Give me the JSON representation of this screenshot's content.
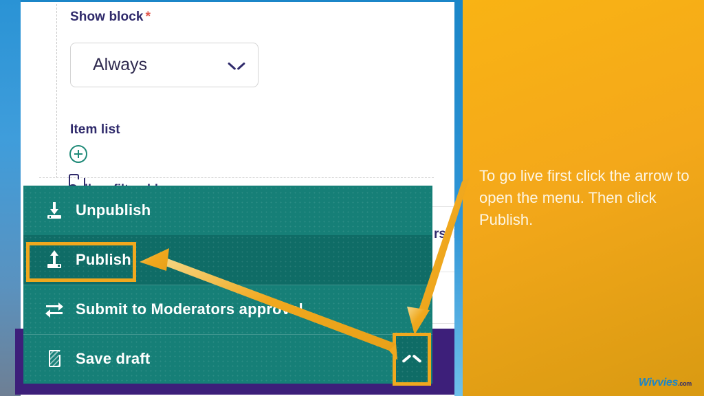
{
  "content_pane": {
    "show_block": {
      "label": "Show block",
      "required_marker": "*",
      "selected_value": "Always",
      "chevron_icon": "chevron-down-icon"
    },
    "item_list": {
      "label": "Item list",
      "add_icon": "plus-circle-icon",
      "rows": [
        {
          "icon": "folder-icon",
          "label": "Gallery filterable group"
        }
      ],
      "obscured_text_fragment": "rs, i"
    }
  },
  "action_menu": {
    "items": [
      {
        "label": "Unpublish",
        "icon": "download-icon",
        "highlighted": false
      },
      {
        "label": "Publish",
        "icon": "upload-icon",
        "highlighted": true
      },
      {
        "label": "Submit to Moderators approval",
        "icon": "exchange-arrows-icon",
        "highlighted": false
      },
      {
        "label": "Save draft",
        "icon": "document-icon",
        "highlighted": false
      }
    ],
    "toggle_button": {
      "icon": "chevron-up-icon",
      "highlighted": true
    }
  },
  "annotations": {
    "arrow_to_publish": "arrow-icon",
    "arrow_to_toggle": "arrow-icon",
    "highlight_color": "#f0a81e"
  },
  "instruction_panel": {
    "text": "To go live first click the arrow to open the menu. Then click Publish.",
    "background_color": "#f4a81a"
  },
  "watermark": {
    "name": "Wivvies",
    "tld": ".com"
  }
}
